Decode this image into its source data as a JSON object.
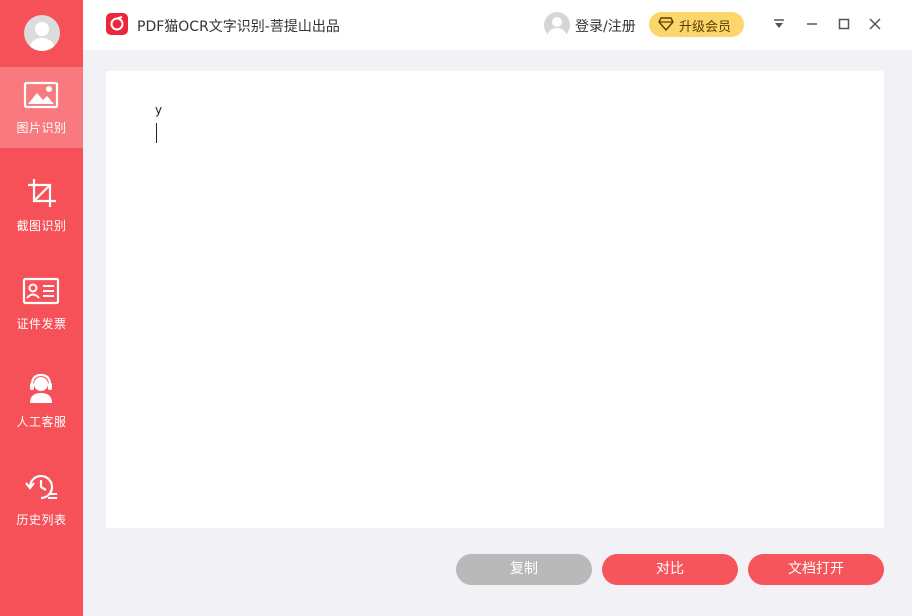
{
  "titlebar": {
    "title": "PDF猫OCR文字识别-菩提山出品",
    "login_label": "登录/注册",
    "upgrade_label": "升级会员"
  },
  "sidebar": {
    "items": [
      {
        "label": "图片识别",
        "icon": "image-icon",
        "active": true
      },
      {
        "label": "截图识别",
        "icon": "crop-icon",
        "active": false
      },
      {
        "label": "证件发票",
        "icon": "id-card-icon",
        "active": false
      },
      {
        "label": "人工客服",
        "icon": "headset-icon",
        "active": false
      },
      {
        "label": "历史列表",
        "icon": "history-icon",
        "active": false
      }
    ]
  },
  "content": {
    "text": "y"
  },
  "actions": {
    "copy_label": "复制",
    "compare_label": "对比",
    "open_label": "文档打开"
  },
  "colors": {
    "brand": "#f65158",
    "sidebar_active": "#f87a7f",
    "upgrade": "#fcd66a",
    "disabled_button": "#b9b9b9"
  }
}
